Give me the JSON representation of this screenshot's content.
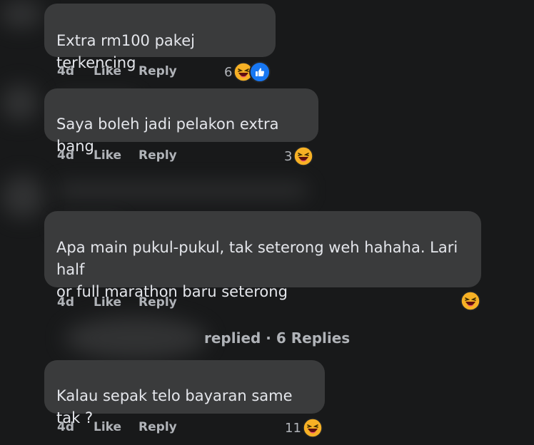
{
  "comments": [
    {
      "text": "Extra rm100 pakej terkencing",
      "time": "4d",
      "like_label": "Like",
      "reply_label": "Reply",
      "reaction_count": "6",
      "reactions": [
        "haha-emoji-icon",
        "like-icon"
      ]
    },
    {
      "text": "Saya boleh jadi pelakon extra bang",
      "time": "4d",
      "like_label": "Like",
      "reply_label": "Reply",
      "reaction_count": "3",
      "reactions": [
        "haha-emoji-icon"
      ]
    },
    {
      "text": "Apa main pukul-pukul, tak seterong weh hahaha. Lari half\nor full marathon baru seterong",
      "time": "4d",
      "like_label": "Like",
      "reply_label": "Reply",
      "reaction_count": "",
      "reactions": [
        "haha-emoji-icon"
      ]
    },
    {
      "text": "Kalau sepak telo bayaran same tak ?",
      "time": "4d",
      "like_label": "Like",
      "reply_label": "Reply",
      "reaction_count": "11",
      "reactions": [
        "haha-emoji-icon"
      ]
    }
  ],
  "replies_link": "replied · 6 Replies",
  "colors": {
    "background": "#18191a",
    "bubble": "#3a3b3c",
    "text": "#e4e6eb",
    "secondary_text": "#b0b3b8",
    "like_blue": "#1877f2",
    "emoji_yellow": "#f7b125"
  }
}
